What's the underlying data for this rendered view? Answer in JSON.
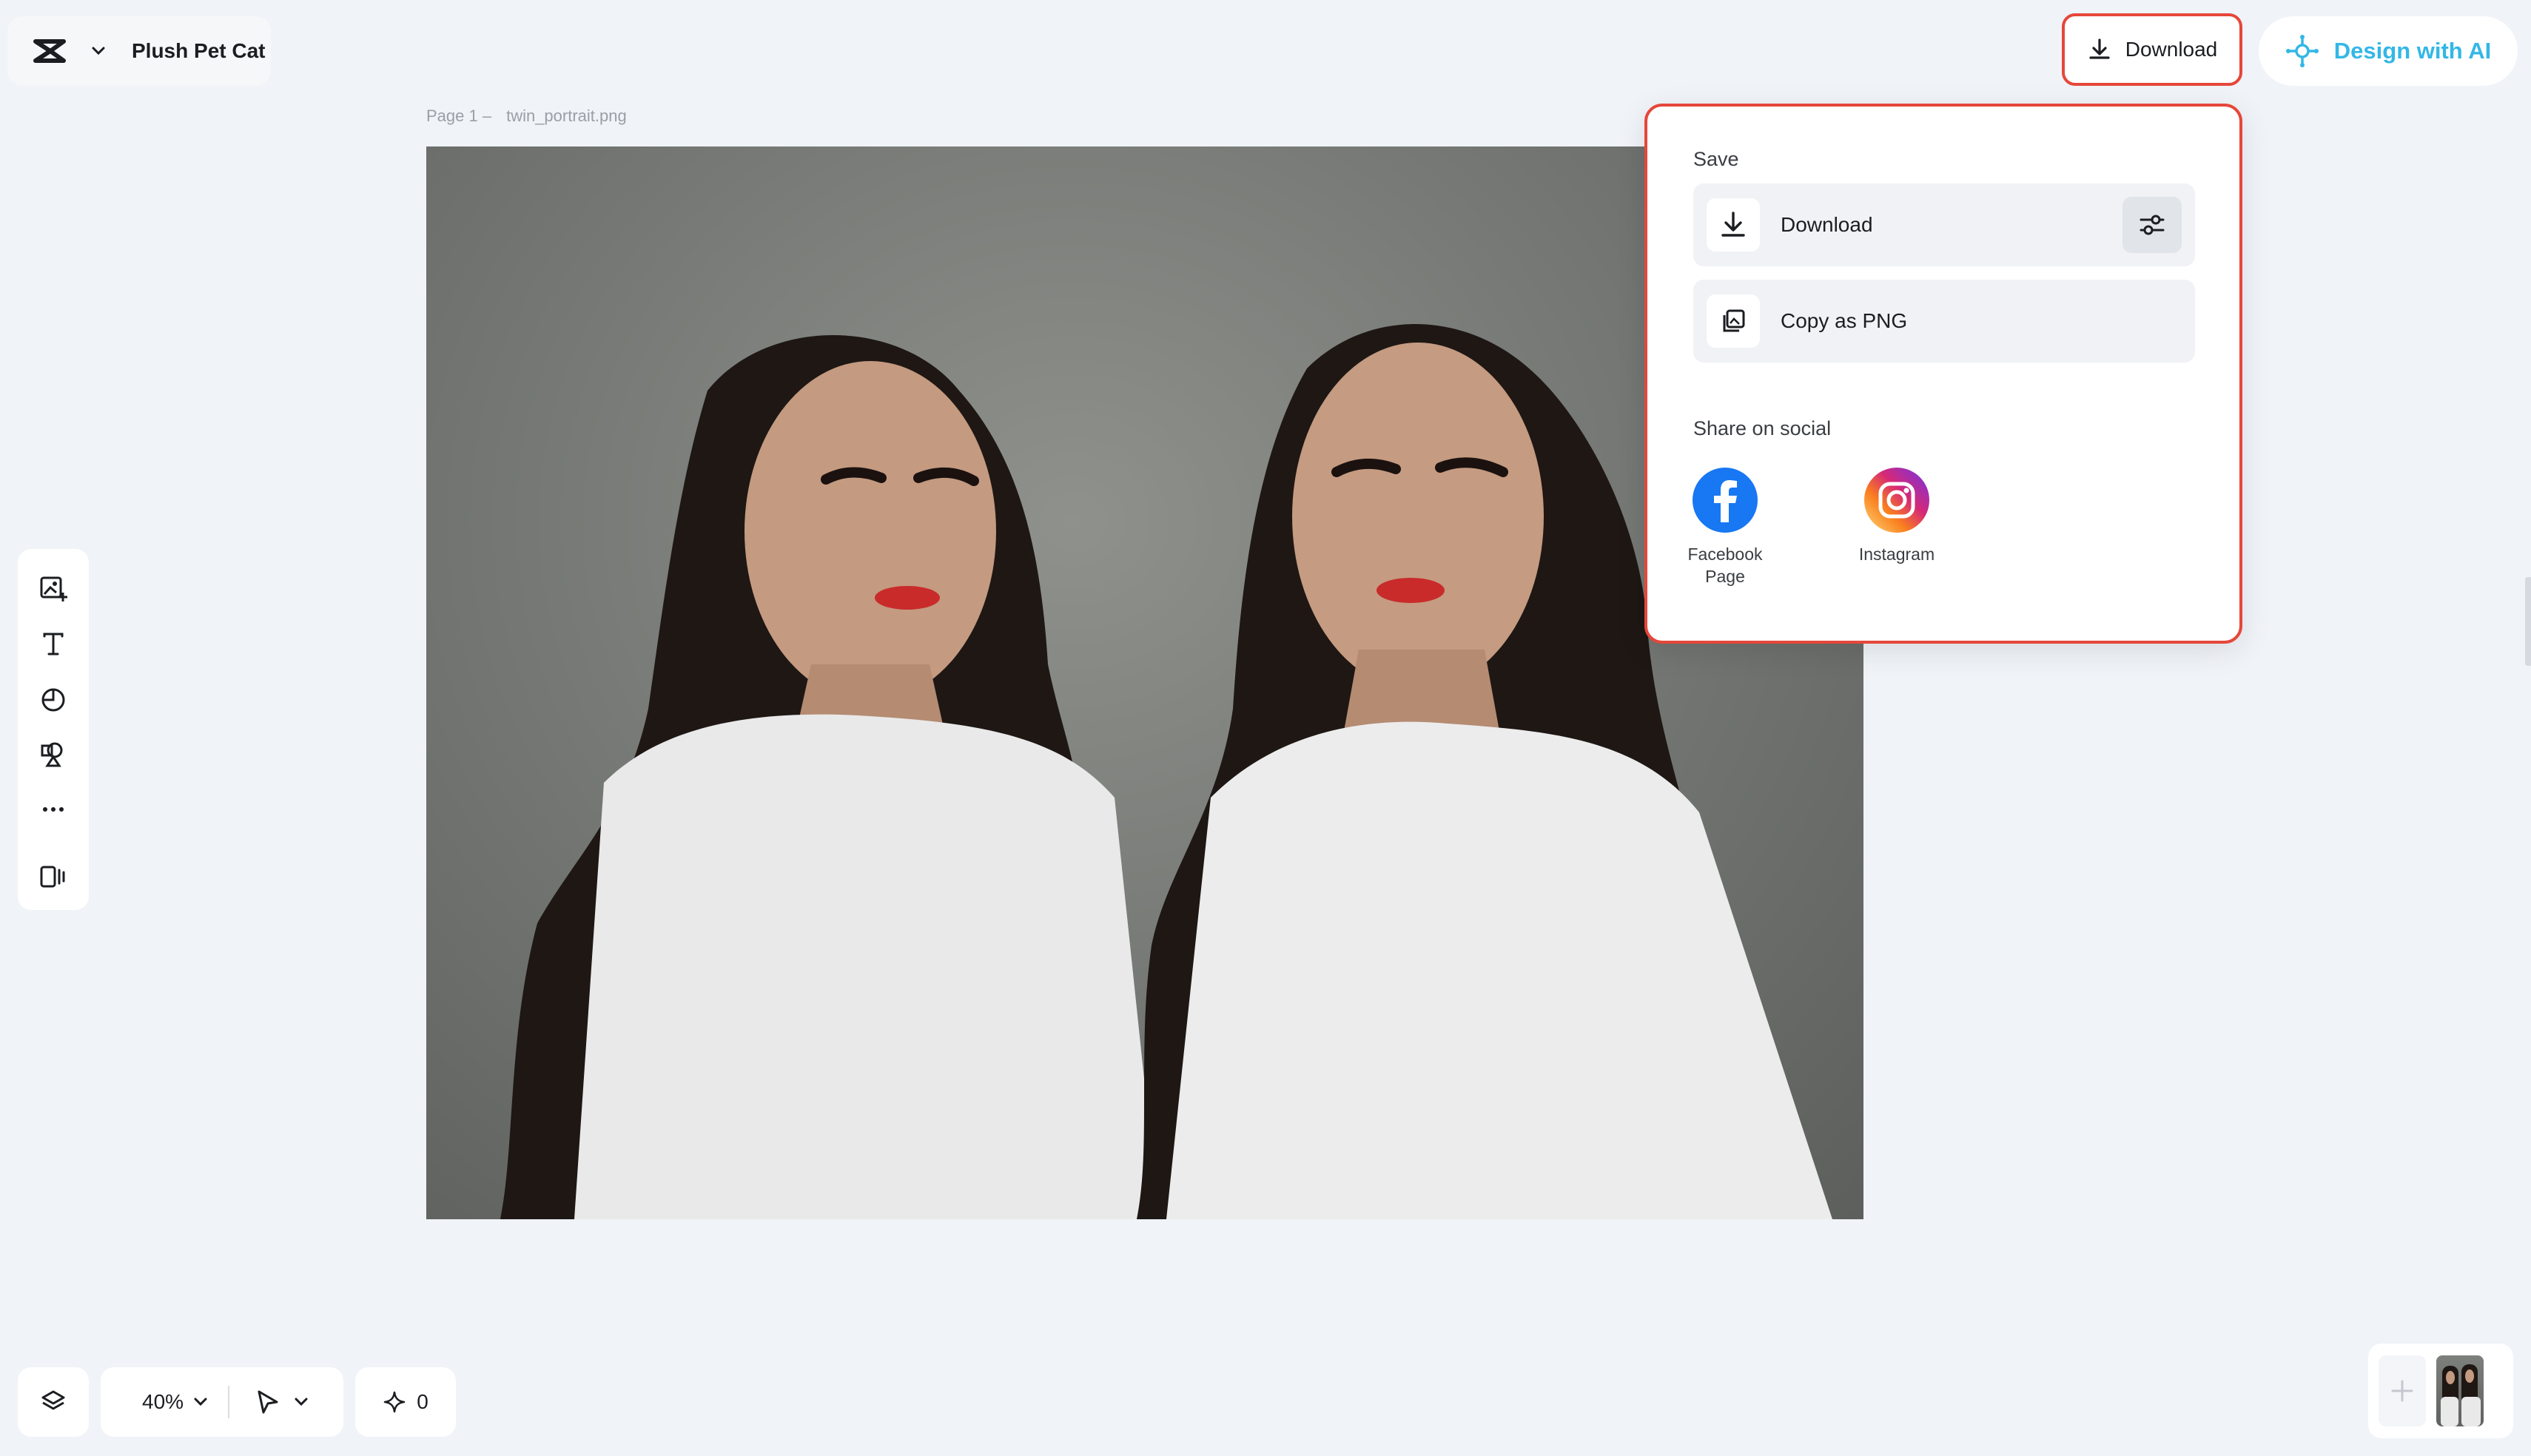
{
  "header": {
    "project_title": "Plush Pet Cat",
    "download_label": "Download",
    "design_ai_label": "Design with AI"
  },
  "canvas": {
    "page_label": "Page 1 –",
    "file_name": "twin_portrait.png"
  },
  "download_menu": {
    "save_section_label": "Save",
    "download_label": "Download",
    "copy_png_label": "Copy as PNG",
    "share_section_label": "Share on social",
    "social": [
      {
        "label": "Facebook Page",
        "icon": "facebook-icon",
        "color": "#1877f2"
      },
      {
        "label": "Instagram",
        "icon": "instagram-icon",
        "color": "#d62976"
      }
    ]
  },
  "left_toolbar": {
    "tools": [
      "add-image-icon",
      "text-icon",
      "shape-icon",
      "elements-icon",
      "more-icon",
      "pages-icon"
    ]
  },
  "bottom_bar": {
    "zoom": "40%",
    "ai_credits": "0"
  },
  "colors": {
    "highlight": "#e5473a",
    "ai_accent": "#33b7e6",
    "background": "#f0f3f7"
  }
}
